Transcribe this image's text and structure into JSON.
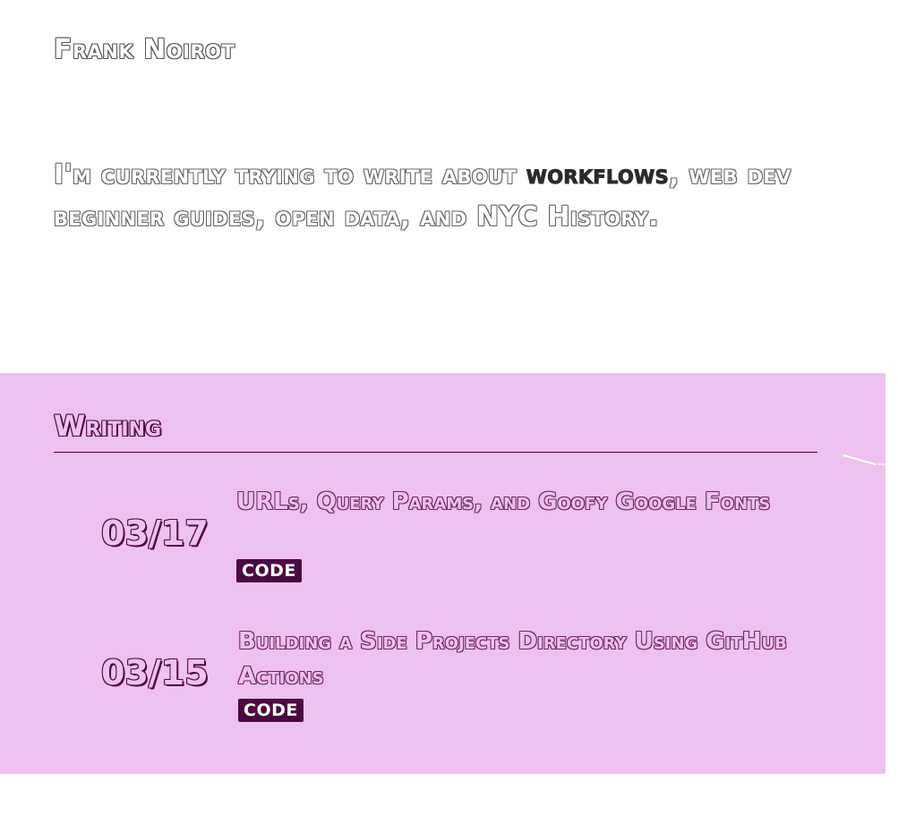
{
  "header": {
    "site_title": "Frank Noirot"
  },
  "intro": {
    "text_before": "I'm currently trying to write about ",
    "highlight": "workflows",
    "text_after": ", web dev beginner guides, open data, and NYC History."
  },
  "writing": {
    "heading": "Writing",
    "posts": [
      {
        "date": "03/17",
        "title": "URLs, Query Params, and Goofy Google Fonts",
        "tag": "CODE"
      },
      {
        "date": "03/15",
        "title": "Building a Side Projects Directory Using GitHub Actions",
        "tag": "CODE"
      }
    ]
  },
  "colors": {
    "section_background": "#efc1ef",
    "accent_dark": "#4a0a40"
  }
}
